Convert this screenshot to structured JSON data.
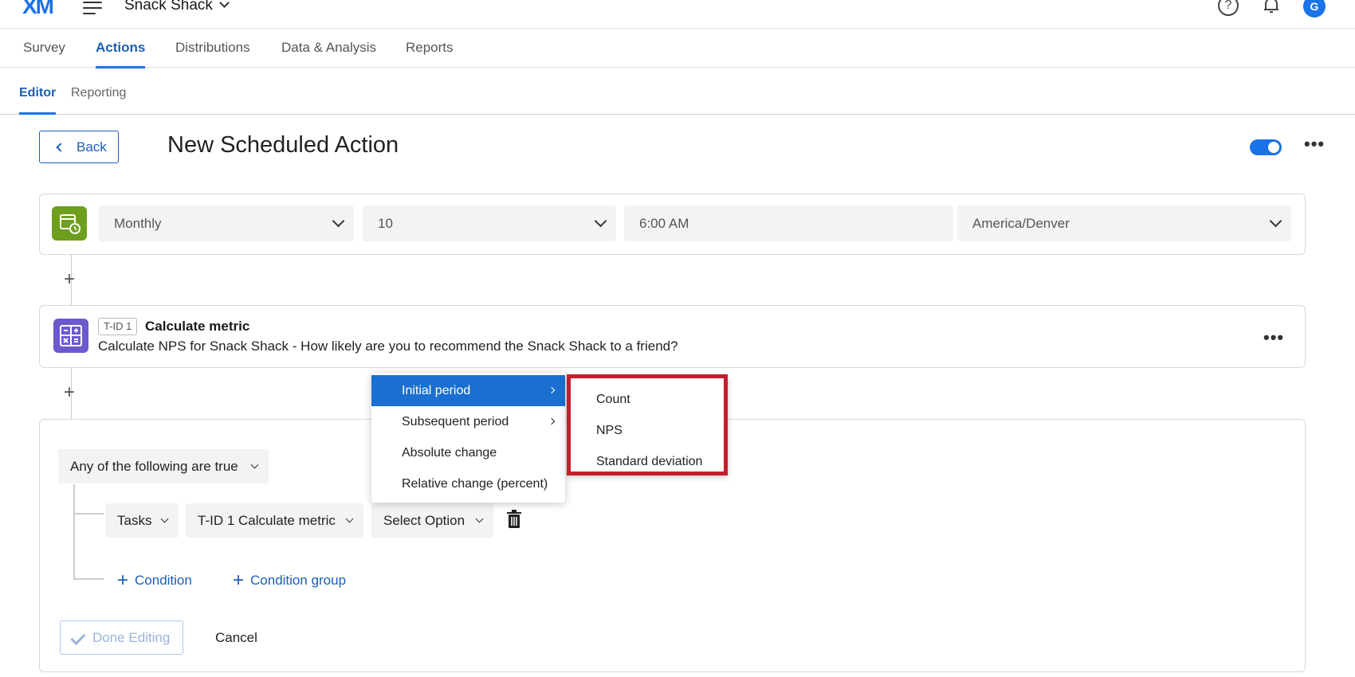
{
  "header": {
    "logo": "XM",
    "project_name": "Snack Shack",
    "help": "?",
    "avatar_initial": "G"
  },
  "nav": {
    "tabs": [
      {
        "label": "Survey"
      },
      {
        "label": "Actions"
      },
      {
        "label": "Distributions"
      },
      {
        "label": "Data & Analysis"
      },
      {
        "label": "Reports"
      }
    ],
    "subtabs": [
      {
        "label": "Editor"
      },
      {
        "label": "Reporting"
      }
    ]
  },
  "page": {
    "back_label": "Back",
    "title": "New Scheduled Action"
  },
  "schedule": {
    "frequency": "Monthly",
    "day": "10",
    "time": "6:00 AM",
    "timezone": "America/Denver"
  },
  "task": {
    "id_badge": "T-ID 1",
    "title": "Calculate metric",
    "description": "Calculate NPS for Snack Shack - How likely are you to recommend the Snack Shack to a friend?"
  },
  "conditions": {
    "logic": "Any of the following are true",
    "row": {
      "type": "Tasks",
      "task": "T-ID 1 Calculate metric",
      "option": "Select Option"
    },
    "add_condition": "Condition",
    "add_group": "Condition group",
    "done_label": "Done Editing",
    "cancel_label": "Cancel"
  },
  "menu": {
    "items": [
      {
        "label": "Initial period"
      },
      {
        "label": "Subsequent period"
      },
      {
        "label": "Absolute change"
      },
      {
        "label": "Relative change (percent)"
      }
    ],
    "submenu": [
      {
        "label": "Count"
      },
      {
        "label": "NPS"
      },
      {
        "label": "Standard deviation"
      }
    ]
  },
  "colors": {
    "accent": "#1a73e8",
    "highlight_border": "#c41e2e",
    "schedule_icon": "#6e9e1e",
    "metric_icon": "#6a5acd"
  }
}
